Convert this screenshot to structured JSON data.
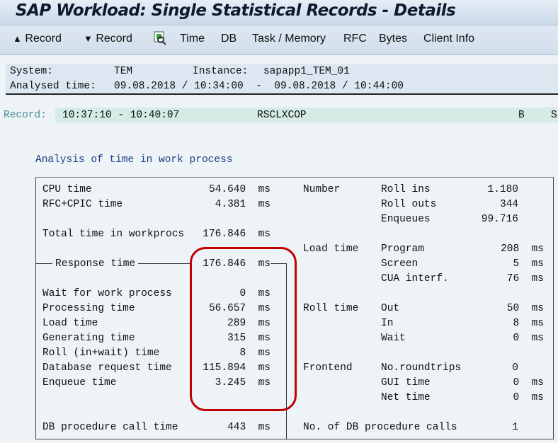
{
  "title": "SAP Workload: Single Statistical Records - Details",
  "toolbar": {
    "prev_record": "Record",
    "next_record": "Record",
    "time": "Time",
    "db": "DB",
    "task_memory": "Task / Memory",
    "rfc": "RFC",
    "bytes": "Bytes",
    "client_info": "Client Info"
  },
  "info": {
    "system_label": "System:",
    "system": "TEM",
    "instance_label": "Instance:",
    "instance": "sapapp1_TEM_01",
    "analysed_label": "Analysed time:",
    "analysed": "09.08.2018 / 10:34:00  -  09.08.2018 / 10:44:00"
  },
  "record": {
    "label": "Record:",
    "time": "10:37:10 - 10:40:07",
    "program": "RSCLXCOP",
    "type": "B",
    "extra": "S"
  },
  "section_title": "Analysis of time in work process",
  "left": [
    {
      "label": "CPU time",
      "value": "54.640",
      "unit": "ms"
    },
    {
      "label": "RFC+CPIC time",
      "value": "4.381",
      "unit": "ms"
    },
    {
      "label": "Total time in workprocs",
      "value": "176.846",
      "unit": "ms"
    },
    {
      "label": "Response time",
      "value": "176.846",
      "unit": "ms"
    },
    {
      "label": "Wait for work process",
      "value": "0",
      "unit": "ms"
    },
    {
      "label": "Processing time",
      "value": "56.657",
      "unit": "ms"
    },
    {
      "label": "Load time",
      "value": "289",
      "unit": "ms"
    },
    {
      "label": "Generating time",
      "value": "315",
      "unit": "ms"
    },
    {
      "label": "Roll (in+wait) time",
      "value": "8",
      "unit": "ms"
    },
    {
      "label": "Database request time",
      "value": "115.894",
      "unit": "ms"
    },
    {
      "label": "Enqueue time",
      "value": "3.245",
      "unit": "ms"
    },
    {
      "label": "DB procedure call time",
      "value": "443",
      "unit": "ms"
    }
  ],
  "right": {
    "number": {
      "label": "Number",
      "rows": [
        {
          "label": "Roll ins",
          "value": "1.180"
        },
        {
          "label": "Roll outs",
          "value": "344"
        },
        {
          "label": "Enqueues",
          "value": "99.716"
        }
      ]
    },
    "load": {
      "label": "Load time",
      "rows": [
        {
          "label": "Program",
          "value": "208",
          "unit": "ms"
        },
        {
          "label": "Screen",
          "value": "5",
          "unit": "ms"
        },
        {
          "label": "CUA interf.",
          "value": "76",
          "unit": "ms"
        }
      ]
    },
    "roll": {
      "label": "Roll time",
      "rows": [
        {
          "label": "Out",
          "value": "50",
          "unit": "ms"
        },
        {
          "label": "In",
          "value": "8",
          "unit": "ms"
        },
        {
          "label": "Wait",
          "value": "0",
          "unit": "ms"
        }
      ]
    },
    "frontend": {
      "label": "Frontend",
      "rows": [
        {
          "label": "No.roundtrips",
          "value": "0"
        },
        {
          "label": "GUI time",
          "value": "0",
          "unit": "ms"
        },
        {
          "label": "Net time",
          "value": "0",
          "unit": "ms"
        }
      ]
    },
    "db_calls": {
      "label": "No. of DB procedure calls",
      "value": "1"
    }
  },
  "colors": {
    "highlight": "#c00000",
    "record_bg": "#d4ebe6"
  }
}
